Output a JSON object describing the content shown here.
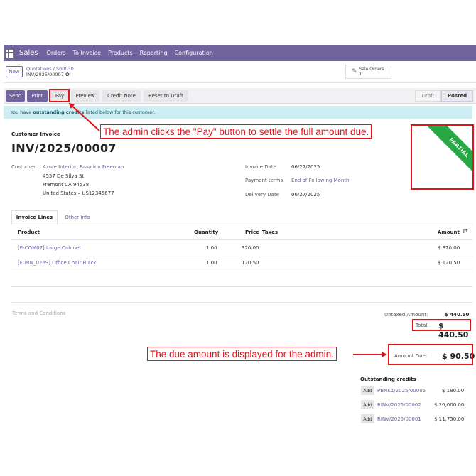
{
  "navbar": {
    "app_name": "Sales",
    "menus": [
      "Orders",
      "To Invoice",
      "Products",
      "Reporting",
      "Configuration"
    ]
  },
  "control": {
    "new_label": "New",
    "breadcrumb_parent": "Quotations",
    "breadcrumb_sep": "/",
    "breadcrumb_order": "S00030",
    "record_name": "INV/2025/00007",
    "smart_button_label": "Sale Orders",
    "smart_button_count": "1"
  },
  "actions": {
    "send": "Send",
    "print": "Print",
    "pay": "Pay",
    "preview": "Preview",
    "credit_note": "Credit Note",
    "reset_to_draft": "Reset to Draft"
  },
  "statusbar": {
    "draft": "Draft",
    "posted": "Posted"
  },
  "alert": {
    "prefix": "You have ",
    "bold": "outstanding credits",
    "suffix": " listed below for this customer."
  },
  "invoice": {
    "type": "Customer Invoice",
    "number": "INV/2025/00007",
    "ribbon": "PARTIAL",
    "customer_label": "Customer",
    "customer_name": "Azure Interior, Brandon Freeman",
    "address_line1": "4557 De Silva St",
    "address_line2": "Fremont CA 94538",
    "address_line3": "United States – US12345677",
    "invoice_date_label": "Invoice Date",
    "invoice_date": "06/27/2025",
    "payment_terms_label": "Payment terms",
    "payment_terms": "End of Following Month",
    "delivery_date_label": "Delivery Date",
    "delivery_date": "06/27/2025"
  },
  "tabs": {
    "invoice_lines": "Invoice Lines",
    "other_info": "Other Info"
  },
  "table": {
    "headers": {
      "product": "Product",
      "quantity": "Quantity",
      "price": "Price",
      "taxes": "Taxes",
      "amount": "Amount"
    },
    "rows": [
      {
        "product": "[E-COM07] Large Cabinet",
        "quantity": "1.00",
        "price": "320.00",
        "amount": "$ 320.00"
      },
      {
        "product": "[FURN_0269] Office Chair Black",
        "quantity": "1.00",
        "price": "120.50",
        "amount": "$ 120.50"
      }
    ]
  },
  "totals": {
    "terms_placeholder": "Terms and Conditions",
    "untaxed_label": "Untaxed Amount:",
    "untaxed_value": "$ 440.50",
    "total_label": "Total:",
    "total_value": "$ 440.50",
    "amount_due_label": "Amount Due:",
    "amount_due_value": "$ 90.50"
  },
  "outstanding": {
    "title": "Outstanding credits",
    "add_label": "Add",
    "items": [
      {
        "ref": "PBNK1/2025/00005",
        "amount": "$ 180.00"
      },
      {
        "ref": "RINV/2025/00002",
        "amount": "$ 20,000.00"
      },
      {
        "ref": "RINV/2025/00001",
        "amount": "$ 11,750.00"
      }
    ]
  },
  "annotations": {
    "pay_note": "The admin clicks the \"Pay\" button to settle the full amount due.",
    "due_note": "The due amount is displayed for the admin.",
    "color": "#e2141b"
  },
  "theme": {
    "primary": "#71639e",
    "alert_bg": "#cfeef4",
    "ribbon": "#28a745"
  }
}
